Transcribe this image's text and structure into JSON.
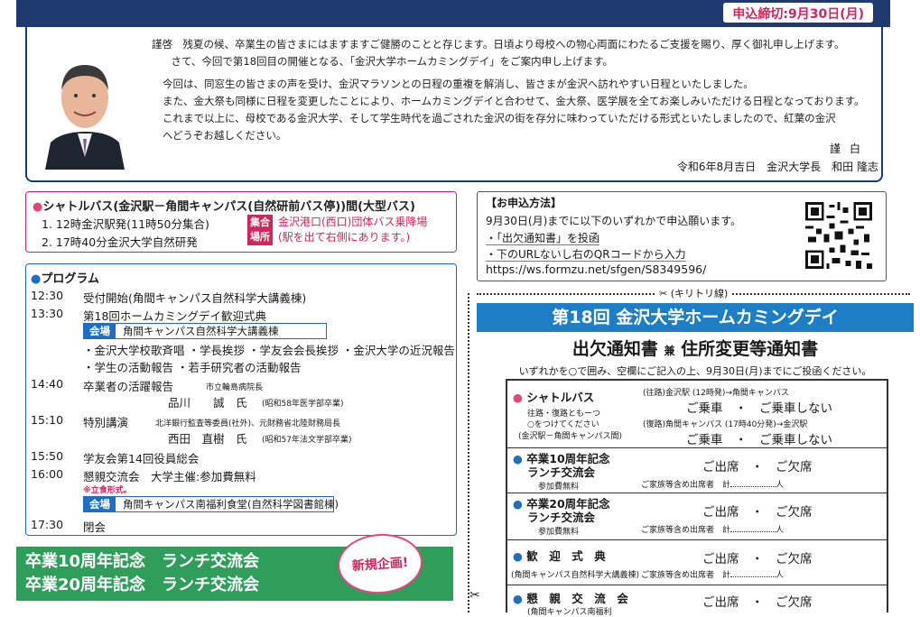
{
  "deadline": "申込締切:9月30日(月)",
  "letter": {
    "lines": [
      "謹啓　残夏の候、卒業生の皆さまにはますますご健勝のことと存じます。日頃より母校への物心両面にわたるご支援を賜り、厚く御礼申し上げます。",
      "　さて、今回で第18回目の開催となる、「金沢大学ホームカミングデイ」をご案内申し上げます。",
      "今回は、同窓生の皆さまの声を受け、金沢マラソンとの日程の重複を解消し、皆さまが金沢へ訪れやすい日程といたしました。",
      "また、金大祭も同様に日程を変更したことにより、ホームカミングデイと合わせて、金大祭、医学展を全てお楽しみいただける日程となっております。",
      "これまで以上に、母校である金沢大学、そして学生時代を過ごされた金沢の街を存分に味わっていただける形式といたしましたので、紅葉の金沢",
      "へどうぞお越しください。"
    ],
    "closing": "謹白",
    "signature": "令和6年8月吉日　金沢大学長　和田 隆志"
  },
  "shuttle": {
    "title": "シャトルバス(金沢駅－角間キャンパス(自然研前バス停))間(大型バス)",
    "line1": "1. 12時金沢駅発(11時50分集合)",
    "line2": "2. 17時40分金沢大学自然研発",
    "meet_tag": "集合場所",
    "meet_place_1": "金沢港口(西口)団体バス乗降場",
    "meet_place_2": "(駅を出て右側にあります。)"
  },
  "program": {
    "title": "プログラム",
    "items": [
      {
        "time": "12:30",
        "desc": "受付開始(角間キャンパス自然科学大講義棟)"
      },
      {
        "time": "13:30",
        "desc": "第18回ホームカミングデイ歓迎式典"
      },
      {
        "time": "14:40",
        "desc": "卒業者の活躍報告"
      },
      {
        "time": "15:10",
        "desc": "特別講演"
      },
      {
        "time": "15:50",
        "desc": "学友会第14回役員総会"
      },
      {
        "time": "16:00",
        "desc": "懇親交流会　大学主催:参加費無料"
      },
      {
        "time": "17:30",
        "desc": "閉会"
      }
    ],
    "venue_tag": "会場",
    "venue1": "角間キャンパス自然科学大講義棟",
    "ceremony_line1": "・金沢大学校歌斉唱 ・学長挨拶 ・学友会会長挨拶 ・金沢大学の近況報告",
    "ceremony_line2": "・学生の活動報告 ・若手研究者の活動報告",
    "speaker1_aff": "市立輪島病院長",
    "speaker1_name": "品川　　誠　氏",
    "speaker1_note": "(昭和58年医学部卒業)",
    "speaker2_aff": "北洋銀行監査等委員(社外)、元財務省北陸財務局長",
    "speaker2_name": "西田　直樹　氏",
    "speaker2_note": "(昭和57年法文学部卒業)",
    "standing": "※立食形式。",
    "venue2": "角間キャンパス南福利食堂(自然科学図書館棟)"
  },
  "lunch": {
    "line1": "卒業10周年記念　ランチ交流会",
    "line2": "卒業20周年記念　ランチ交流会",
    "new_label": "新規企画!"
  },
  "apply": {
    "title": "【お申込方法】",
    "line1": "9月30日(月)までに以下のいずれかで申込願います。",
    "line2": "・「出欠通知書」を投函",
    "line3": "・下のURLないし右のQRコードから入力",
    "url": "https://ws.formzu.net/sfgen/S8349596/"
  },
  "cut_label": "(キリトリ線)",
  "form": {
    "band": "第18回 金沢大学ホームカミングデイ",
    "title_a": "出欠通知書",
    "title_ken": "兼",
    "title_b": "住所変更等通知書",
    "note": "いずれかを○で囲み、空欄にご記入の上、9月30日(月)までにご投函ください。",
    "shuttle_label": "シャトルバス",
    "shuttle_sub1": "往路・復路ともーつ",
    "shuttle_sub2": "○をつけてください",
    "shuttle_sub3": "(金沢駅－角間キャンパス間)",
    "outbound": "(往路)金沢駅 (12時発)→角間キャンパス",
    "inbound": "(復路)角間キャンパス (17時40分発)→金沢駅",
    "ride_choice": "ご乗車　・　ご乗車しない",
    "row10_label1": "卒業10周年記念",
    "row10_label2": "ランチ交流会",
    "row20_label1": "卒業20周年記念",
    "row20_label2": "ランチ交流会",
    "fee_free": "参加費無料",
    "welcome_label": "歓　迎　式　典",
    "welcome_sub": "(角間キャンパス自然科学大講義棟)",
    "party_label": "懇　親　交　流　会",
    "party_sub": "(角間キャンパス南福利",
    "attend_choice": "ご出席　・　ご欠席",
    "family": "ご家族等含め出席者",
    "total": "計",
    "persons": "人"
  }
}
